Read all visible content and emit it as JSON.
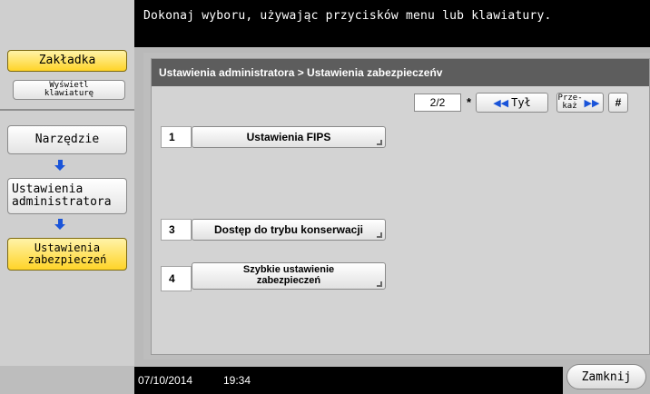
{
  "message": "Dokonaj wyboru, używając przycisków menu lub klawiatury.",
  "sidebar": {
    "tab_label": "Zakładka",
    "keyboard_label": "Wyświetl klawiaturę",
    "path": [
      {
        "label": "Narzędzie"
      },
      {
        "label": "Ustawienia administratora"
      },
      {
        "label": "Ustawienia zabezpieczeń"
      }
    ]
  },
  "breadcrumb": "Ustawienia administratora > Ustawienia zabezpieczeńv",
  "pager": {
    "count": "2/2",
    "star": "*",
    "back_label": "Tył",
    "next_label": "Prze- każ",
    "hash": "#"
  },
  "items": [
    {
      "num": "1",
      "label": "Ustawienia FIPS"
    },
    {
      "num": "3",
      "label": "Dostęp do trybu konserwacji"
    },
    {
      "num": "4",
      "label": "Szybkie ustawienie zabezpieczeń"
    }
  ],
  "status": {
    "date": "07/10/2014",
    "time": "19:34"
  },
  "close_label": "Zamknij",
  "colors": {
    "accent_yellow": "#ffd428",
    "arrow_blue": "#1a54d9"
  }
}
